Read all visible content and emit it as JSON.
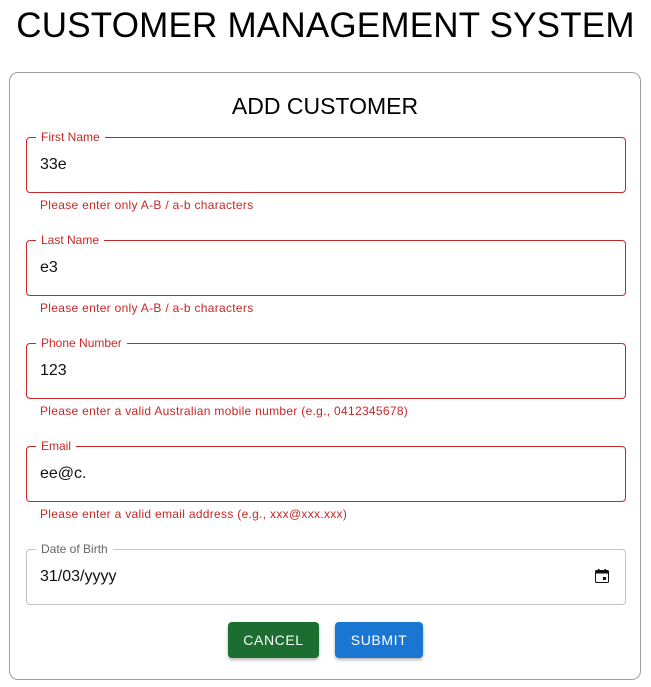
{
  "page": {
    "title": "CUSTOMER MANAGEMENT SYSTEM"
  },
  "form": {
    "title": "ADD CUSTOMER",
    "fields": {
      "first_name": {
        "label": "First Name",
        "value": "33e",
        "error": "Please enter only A-B / a-b characters"
      },
      "last_name": {
        "label": "Last Name",
        "value": "e3",
        "error": "Please enter only A-B / a-b characters"
      },
      "phone": {
        "label": "Phone Number",
        "value": "123",
        "error": "Please enter a valid Australian mobile number (e.g., 0412345678)"
      },
      "email": {
        "label": "Email",
        "value": "ee@c.",
        "error": "Please enter a valid email address (e.g., xxx@xxx.xxx)"
      },
      "dob": {
        "label": "Date of Birth",
        "value": "31/03/yyyy"
      }
    },
    "buttons": {
      "cancel_label": "CANCEL",
      "submit_label": "SUBMIT"
    }
  },
  "colors": {
    "error": "#c62828",
    "cancel_button": "#1b6e2f",
    "submit_button": "#1976d2"
  },
  "icons": {
    "date_picker": "calendar-icon"
  }
}
